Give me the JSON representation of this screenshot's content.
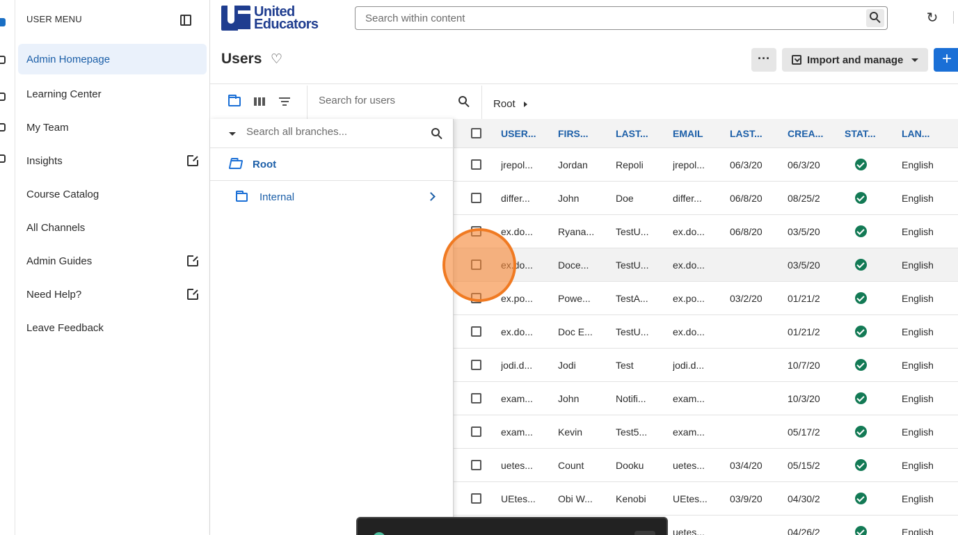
{
  "sidebar": {
    "header": "USER MENU",
    "items": [
      {
        "label": "Admin Homepage",
        "active": true,
        "external": false
      },
      {
        "label": "Learning Center",
        "active": false,
        "external": false
      },
      {
        "label": "My Team",
        "active": false,
        "external": false
      },
      {
        "label": "Insights",
        "active": false,
        "external": true
      },
      {
        "label": "Course Catalog",
        "active": false,
        "external": false
      },
      {
        "label": "All Channels",
        "active": false,
        "external": false
      },
      {
        "label": "Admin Guides",
        "active": false,
        "external": true
      },
      {
        "label": "Need Help?",
        "active": false,
        "external": true
      },
      {
        "label": "Leave Feedback",
        "active": false,
        "external": false
      }
    ]
  },
  "header": {
    "logo_line1": "United",
    "logo_line2": "Educators",
    "search_placeholder": "Search within content",
    "refresh_icon": "↻"
  },
  "page": {
    "title": "Users",
    "favorite_icon": "♡",
    "more_label": "···",
    "import_label": "Import and manage",
    "add_label": "+"
  },
  "toolbar": {
    "user_search_placeholder": "Search for users",
    "breadcrumb": "Root"
  },
  "branches": {
    "search_placeholder": "Search all branches...",
    "root_label": "Root",
    "child_label": "Internal"
  },
  "table": {
    "columns": [
      "USER...",
      "FIRS...",
      "LAST...",
      "EMAIL",
      "LAST...",
      "CREA...",
      "STAT...",
      "LAN..."
    ],
    "rows": [
      {
        "user": "jrepol...",
        "first": "Jordan",
        "last": "Repoli",
        "email": "jrepol...",
        "last_login": "06/3/20",
        "created": "06/3/20",
        "status": "active",
        "language": "English"
      },
      {
        "user": "differ...",
        "first": "John",
        "last": "Doe",
        "email": "differ...",
        "last_login": "06/8/20",
        "created": "08/25/2",
        "status": "active",
        "language": "English"
      },
      {
        "user": "ex.do...",
        "first": "Ryana...",
        "last": "TestU...",
        "email": "ex.do...",
        "last_login": "06/8/20",
        "created": "03/5/20",
        "status": "active",
        "language": "English"
      },
      {
        "user": "ex.do...",
        "first": "Doce...",
        "last": "TestU...",
        "email": "ex.do...",
        "last_login": "",
        "created": "03/5/20",
        "status": "active",
        "language": "English"
      },
      {
        "user": "ex.po...",
        "first": "Powe...",
        "last": "TestA...",
        "email": "ex.po...",
        "last_login": "03/2/20",
        "created": "01/21/2",
        "status": "active",
        "language": "English"
      },
      {
        "user": "ex.do...",
        "first": "Doc E...",
        "last": "TestU...",
        "email": "ex.do...",
        "last_login": "",
        "created": "01/21/2",
        "status": "active",
        "language": "English"
      },
      {
        "user": "jodi.d...",
        "first": "Jodi",
        "last": "Test",
        "email": "jodi.d...",
        "last_login": "",
        "created": "10/7/20",
        "status": "active",
        "language": "English"
      },
      {
        "user": "exam...",
        "first": "John",
        "last": "Notifi...",
        "email": "exam...",
        "last_login": "",
        "created": "10/3/20",
        "status": "active",
        "language": "English"
      },
      {
        "user": "exam...",
        "first": "Kevin",
        "last": "Test5...",
        "email": "exam...",
        "last_login": "",
        "created": "05/17/2",
        "status": "active",
        "language": "English"
      },
      {
        "user": "uetes...",
        "first": "Count",
        "last": "Dooku",
        "email": "uetes...",
        "last_login": "03/4/20",
        "created": "05/15/2",
        "status": "active",
        "language": "English"
      },
      {
        "user": "UEtes...",
        "first": "Obi W...",
        "last": "Kenobi",
        "email": "UEtes...",
        "last_login": "03/9/20",
        "created": "04/30/2",
        "status": "active",
        "language": "English"
      },
      {
        "user": "",
        "first": "",
        "last": "",
        "email": "uetes...",
        "last_login": "",
        "created": "04/26/2",
        "status": "active",
        "language": "English"
      }
    ],
    "highlighted_row": 3
  },
  "colors": {
    "accent": "#1a6fd6",
    "link": "#1c5fa8",
    "status_active": "#137a55",
    "marker": "#f07a22"
  }
}
